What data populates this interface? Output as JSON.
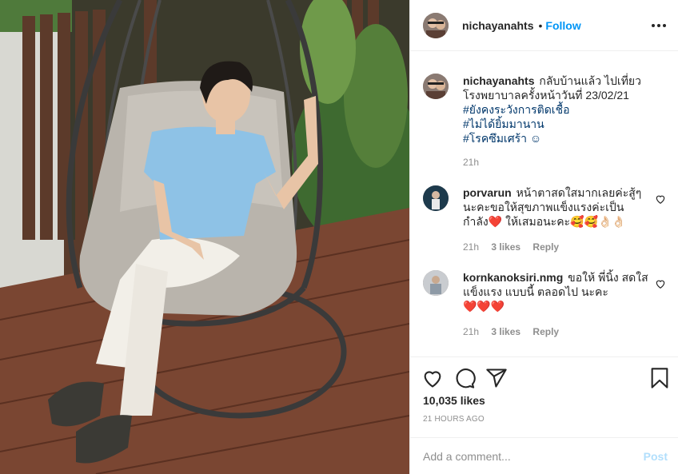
{
  "post": {
    "author": {
      "username": "nichayanahts",
      "follow_label": "Follow",
      "separator": "•"
    },
    "caption": {
      "username": "nichayanahts",
      "text": "กลับบ้านแล้ว ไปเที่ยวโรงพยาบาลครั้งหน้าวันที่ 23/02/21",
      "hashtags": [
        "#ยังคงระวังการติดเชื้อ",
        "#ไม่ได้ยิ้มมานาน",
        "#โรคซึมเศร้า ☺"
      ],
      "time": "21h"
    },
    "comments": [
      {
        "username": "porvarun",
        "text": "หน้าตาสดใสมากเลยค่ะสู้ๆ นะคะขอให้สุขภาพแข็งแรงค่ะเป็นกำลัง❤️ ให้เสมอนะคะ🥰🥰👌🏻👌🏻",
        "time": "21h",
        "likes": "3 likes",
        "reply_label": "Reply"
      },
      {
        "username": "kornkanoksiri.nmg",
        "text": "ขอให้ พี่นิ้ง สดใส แข็งแรง แบบนี้ ตลอดไป นะคะ",
        "hearts": "❤️❤️❤️",
        "time": "21h",
        "likes": "3 likes",
        "reply_label": "Reply"
      }
    ],
    "likes_count": "10,035 likes",
    "timestamp": "21 HOURS AGO",
    "comment_input": {
      "placeholder": "Add a comment...",
      "value": ""
    },
    "post_button": "Post",
    "icons": [
      "heart-icon",
      "comment-icon",
      "share-icon",
      "bookmark-icon",
      "more-icon"
    ],
    "colors": {
      "link": "#0095f6",
      "hashtag": "#00376b",
      "muted": "#8e8e8e",
      "post_disabled": "#b2dffc",
      "heart": "#ed4956"
    }
  }
}
